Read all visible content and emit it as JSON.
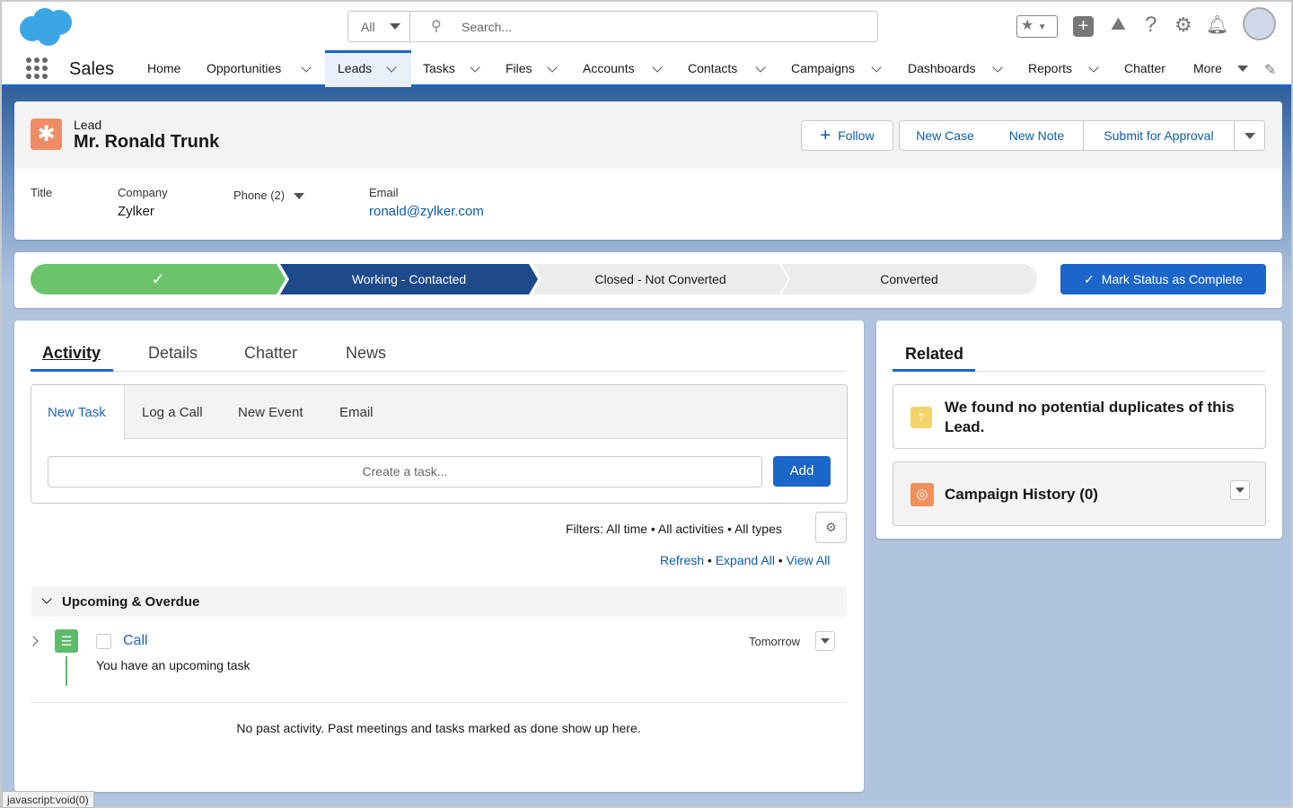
{
  "header": {
    "search_scope": "All",
    "search_placeholder": "Search...",
    "app_name": "Sales"
  },
  "nav": {
    "items": [
      "Home",
      "Opportunities",
      "Leads",
      "Tasks",
      "Files",
      "Accounts",
      "Contacts",
      "Campaigns",
      "Dashboards",
      "Reports",
      "Chatter",
      "More"
    ],
    "active": "Leads"
  },
  "record": {
    "object": "Lead",
    "name": "Mr. Ronald Trunk",
    "actions": {
      "follow": "Follow",
      "new_case": "New Case",
      "new_note": "New Note",
      "submit": "Submit for Approval"
    },
    "fields": {
      "title_label": "Title",
      "company_label": "Company",
      "company": "Zylker",
      "phone_label": "Phone (2)",
      "email_label": "Email",
      "email": "ronald@zylker.com"
    }
  },
  "path": {
    "stages": [
      "Working - Contacted",
      "Closed - Not Converted",
      "Converted"
    ],
    "complete_button": "Mark Status as Complete"
  },
  "activity": {
    "tabs": [
      "Activity",
      "Details",
      "Chatter",
      "News"
    ],
    "composer_tabs": [
      "New Task",
      "Log a Call",
      "New Event",
      "Email"
    ],
    "task_placeholder": "Create a task...",
    "add": "Add",
    "filters": "Filters: All time • All activities • All types",
    "links": [
      "Refresh",
      "Expand All",
      "View All"
    ],
    "section": "Upcoming & Overdue",
    "task": {
      "title": "Call",
      "subtitle": "You have an upcoming task",
      "due": "Tomorrow"
    },
    "empty": "No past activity. Past meetings and tasks marked as done show up here."
  },
  "related": {
    "tab": "Related",
    "duplicates": "We found no potential duplicates of this Lead.",
    "campaign": "Campaign History (0)"
  },
  "status_bar": "javascript:void(0)",
  "colors": {
    "brand": "#1b66c9",
    "complete": "#6bc36b",
    "current": "#1c4a8a"
  }
}
